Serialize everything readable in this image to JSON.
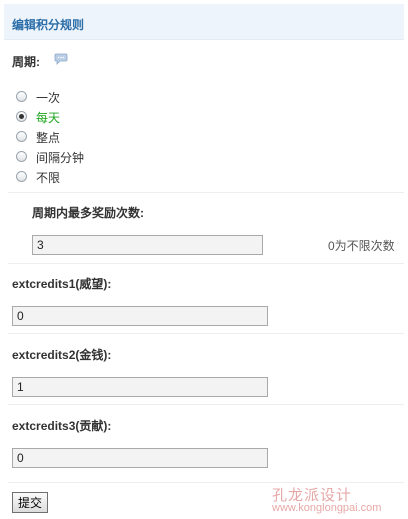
{
  "header": {
    "title": "编辑积分规则"
  },
  "period": {
    "label": "周期:",
    "help_icon": "speech-bubble-help-icon",
    "options": [
      {
        "label": "一次",
        "checked": false
      },
      {
        "label": "每天",
        "checked": true
      },
      {
        "label": "整点",
        "checked": false
      },
      {
        "label": "间隔分钟",
        "checked": false
      },
      {
        "label": "不限",
        "checked": false
      }
    ]
  },
  "max_rewards": {
    "label": "周期内最多奖励次数:",
    "value": "3",
    "hint": "0为不限次数"
  },
  "extcredits1": {
    "label": "extcredits1(威望):",
    "value": "0"
  },
  "extcredits2": {
    "label": "extcredits2(金钱):",
    "value": "1"
  },
  "extcredits3": {
    "label": "extcredits3(贡献):",
    "value": "0"
  },
  "submit_label": "提交",
  "watermark": {
    "text": "孔龙派设计",
    "url": "www.konglongpai.com"
  },
  "colors": {
    "header_bg": "#eef4fb",
    "header_text": "#2b6da8",
    "active_option": "#1ea51e"
  }
}
